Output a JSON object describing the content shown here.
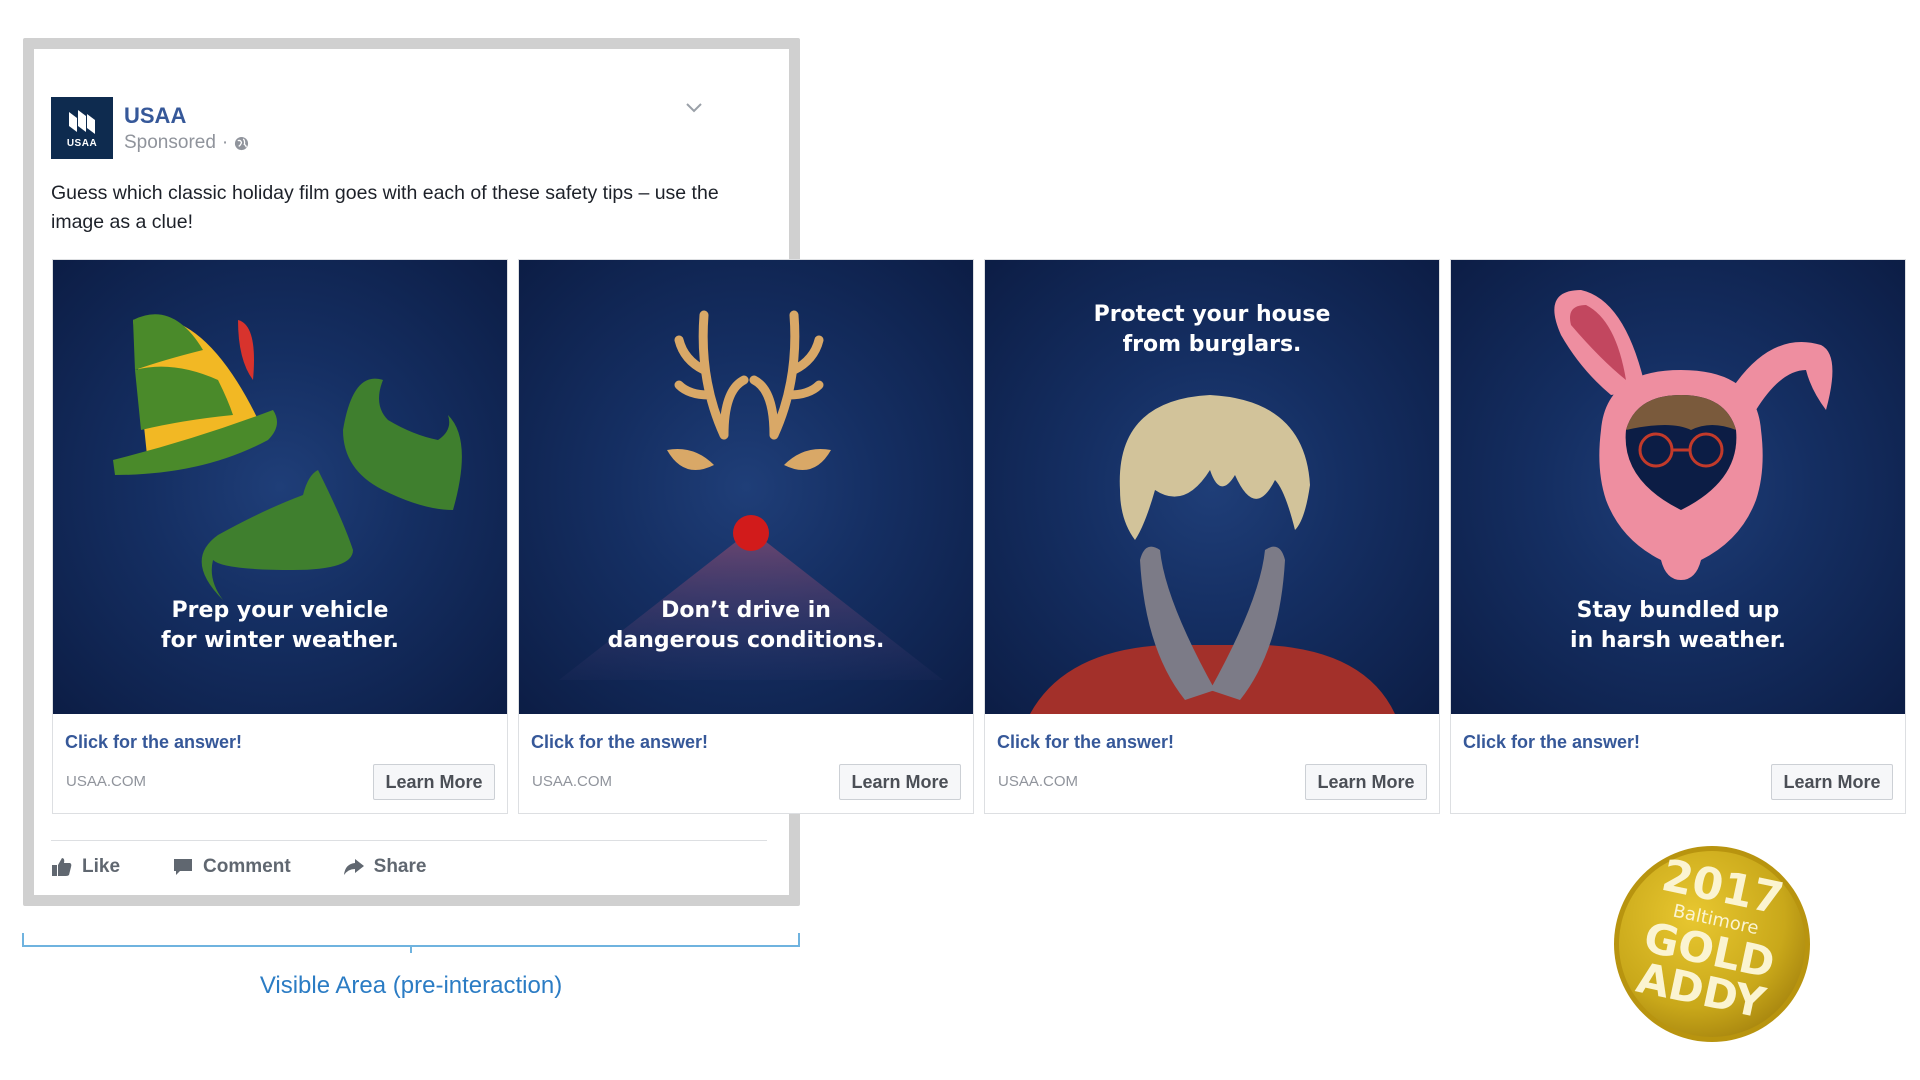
{
  "post": {
    "page_name": "USAA",
    "logo_text": "USAA",
    "sponsored": "Sponsored",
    "separator": "·",
    "text": "Guess which classic holiday film goes with each of these safety tips – use the image as a clue!"
  },
  "cards": [
    {
      "caption_line1": "Prep your vehicle",
      "caption_line2": "for winter weather.",
      "title": "Click for the answer!",
      "domain": "USAA.COM",
      "button": "Learn More",
      "illustration": "elf-hat-and-shoes"
    },
    {
      "caption_line1": "Don’t drive in",
      "caption_line2": "dangerous conditions.",
      "title": "Click for the answer!",
      "domain": "USAA.COM",
      "button": "Learn More",
      "illustration": "reindeer-red-nose"
    },
    {
      "caption_line1": "Protect your house",
      "caption_line2": "from burglars.",
      "title": "Click for the answer!",
      "domain": "USAA.COM",
      "button": "Learn More",
      "illustration": "boy-hands-on-cheeks"
    },
    {
      "caption_line1": "Stay bundled up",
      "caption_line2": "in harsh weather.",
      "title": "Click for the answer!",
      "domain": "",
      "button": "Learn More",
      "illustration": "pink-bunny-suit"
    }
  ],
  "actions": {
    "like": "Like",
    "comment": "Comment",
    "share": "Share"
  },
  "annotation": {
    "visible_area": "Visible Area (pre-interaction)"
  },
  "award": {
    "year": "2017",
    "city": "Baltimore",
    "level": "GOLD",
    "name": "ADDY"
  },
  "colors": {
    "link_blue": "#365899",
    "card_navy": "#0c1d45",
    "annotation_blue": "#2b7cc4",
    "award_gold": "#c9a81a"
  }
}
